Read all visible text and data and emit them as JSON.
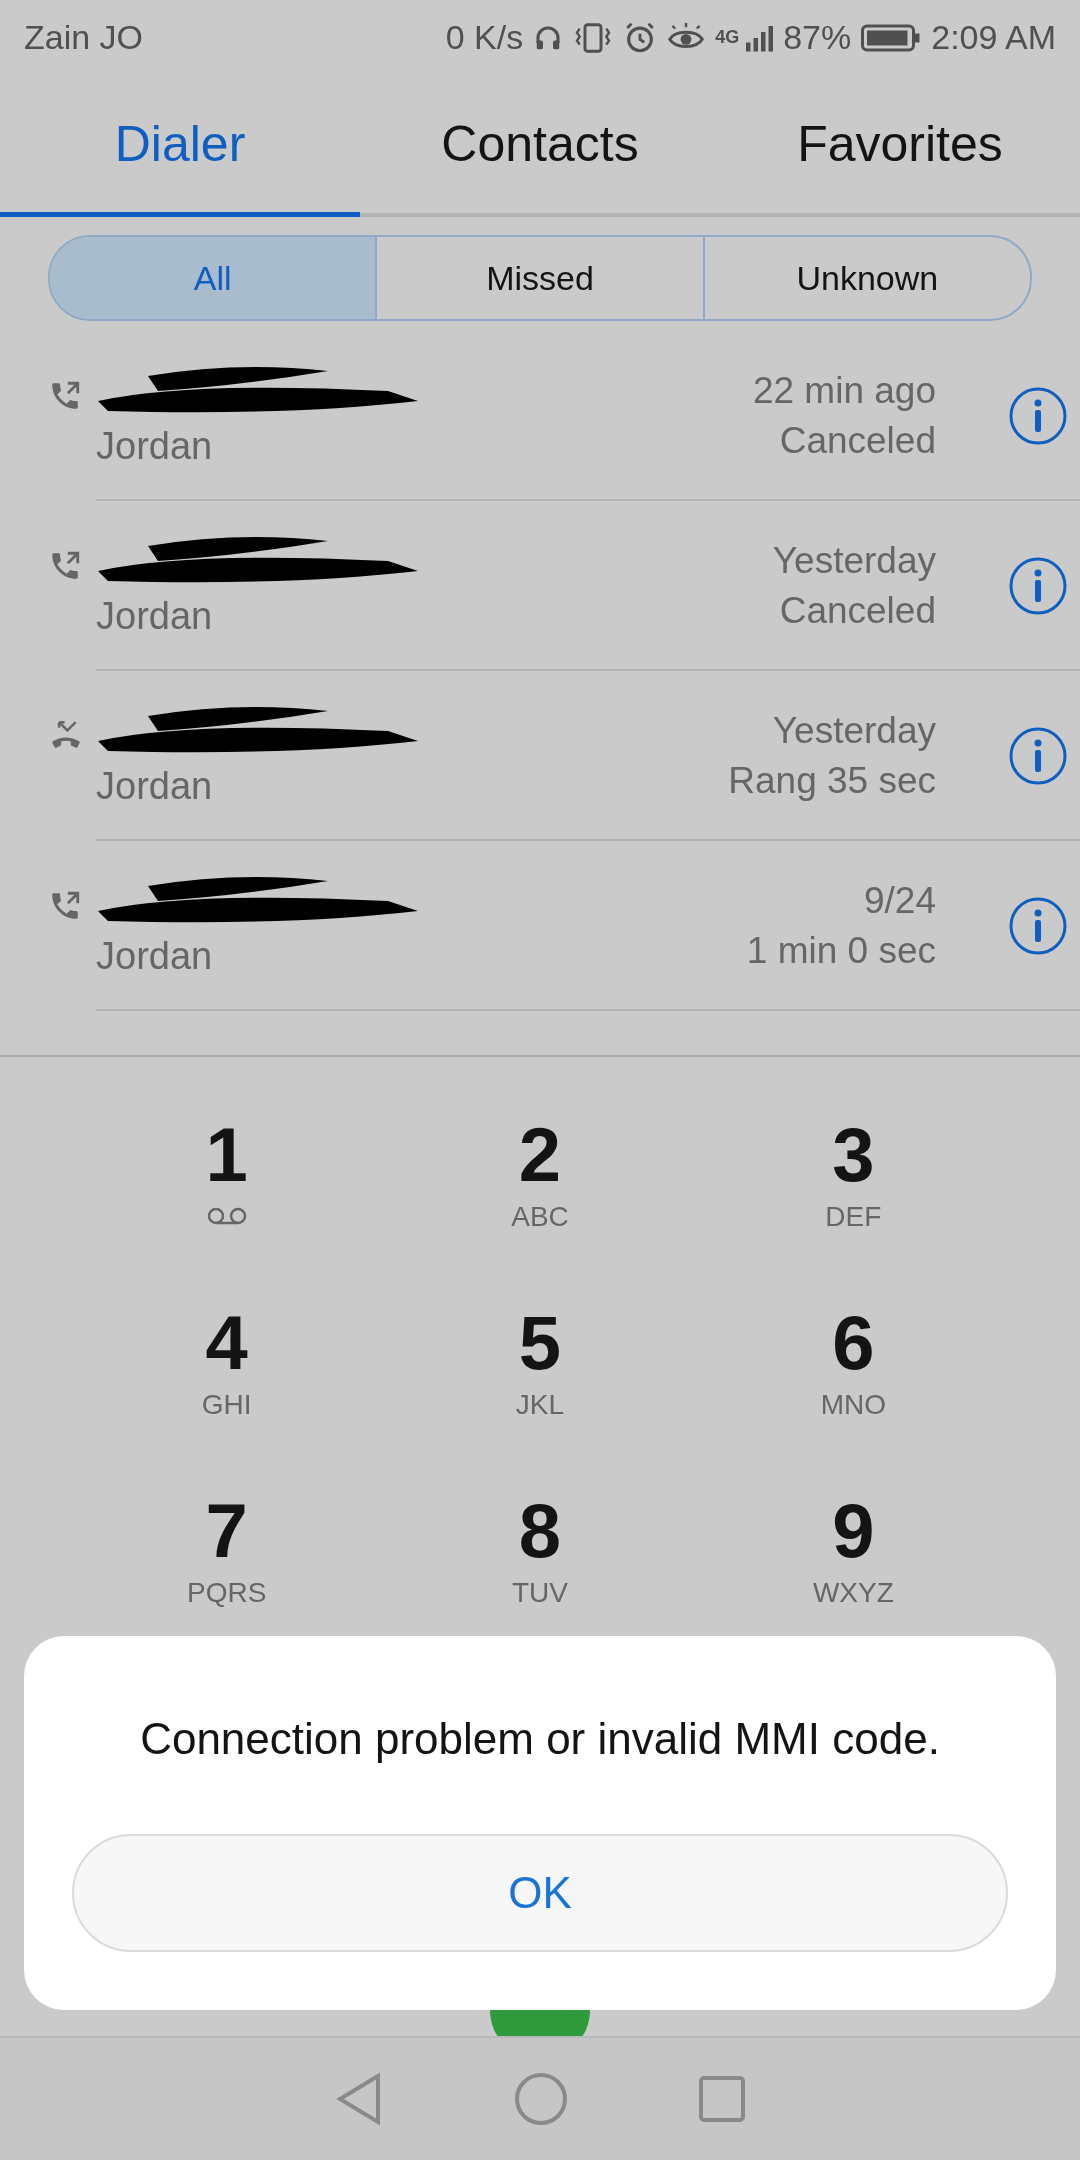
{
  "status_bar": {
    "carrier": "Zain JO",
    "speed": "0 K/s",
    "network": "4G",
    "battery": "87%",
    "time": "2:09 AM"
  },
  "tabs": [
    {
      "label": "Dialer",
      "selected": true
    },
    {
      "label": "Contacts",
      "selected": false
    },
    {
      "label": "Favorites",
      "selected": false
    }
  ],
  "filters": [
    {
      "label": "All",
      "selected": true
    },
    {
      "label": "Missed",
      "selected": false
    },
    {
      "label": "Unknown",
      "selected": false
    }
  ],
  "calls": [
    {
      "kind": "outgoing",
      "location": "Jordan",
      "time": "22 min ago",
      "detail": "Canceled"
    },
    {
      "kind": "outgoing",
      "location": "Jordan",
      "time": "Yesterday",
      "detail": "Canceled"
    },
    {
      "kind": "rejected",
      "location": "Jordan",
      "time": "Yesterday",
      "detail": "Rang 35 sec"
    },
    {
      "kind": "outgoing",
      "location": "Jordan",
      "time": "9/24",
      "detail": "1 min 0 sec"
    }
  ],
  "keypad": [
    {
      "kind": "voicemail",
      "digit": "1"
    },
    {
      "kind": "letters",
      "digit": "2",
      "letters": "ABC"
    },
    {
      "kind": "letters",
      "digit": "3",
      "letters": "DEF"
    },
    {
      "kind": "letters",
      "digit": "4",
      "letters": "GHI"
    },
    {
      "kind": "letters",
      "digit": "5",
      "letters": "JKL"
    },
    {
      "kind": "letters",
      "digit": "6",
      "letters": "MNO"
    },
    {
      "kind": "letters",
      "digit": "7",
      "letters": "PQRS"
    },
    {
      "kind": "letters",
      "digit": "8",
      "letters": "TUV"
    },
    {
      "kind": "letters",
      "digit": "9",
      "letters": "WXYZ"
    }
  ],
  "dialog": {
    "message": "Connection problem or invalid MMI code.",
    "button": "OK"
  }
}
